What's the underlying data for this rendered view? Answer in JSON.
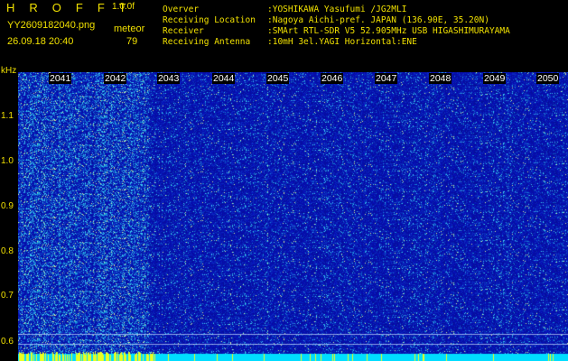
{
  "header": {
    "app_name": "H R O F F T",
    "version": "1.0.0f",
    "filename": "YY2609182040.png",
    "type": "meteor",
    "datetime": "26.09.18 20:40",
    "count": "79"
  },
  "info": [
    {
      "key": "Overver",
      "value": ":YOSHIKAWA Yasufumi /JG2MLI"
    },
    {
      "key": "Receiving Location",
      "value": ":Nagoya Aichi-pref. JAPAN (136.90E, 35.20N)"
    },
    {
      "key": "Receiver",
      "value": ":SMArt RTL-SDR V5 52.905MHz USB HIGASHIMURAYAMA"
    },
    {
      "key": "Receiving Antenna",
      "value": ":10mH 3el.YAGI Horizontal:ENE"
    }
  ],
  "axis": {
    "y_unit": "kHz",
    "y_ticks": [
      "1.1",
      "1.0",
      "0.9",
      "0.8",
      "0.7",
      "0.6"
    ],
    "x_ticks": [
      "2041",
      "2042",
      "2043",
      "2044",
      "2045",
      "2046",
      "2047",
      "2048",
      "2049",
      "2050"
    ]
  },
  "colors": {
    "background": "#000000",
    "label": "#f0e000",
    "spectrogram_base": "#08109a",
    "bottom_bar": "#00ddff"
  }
}
